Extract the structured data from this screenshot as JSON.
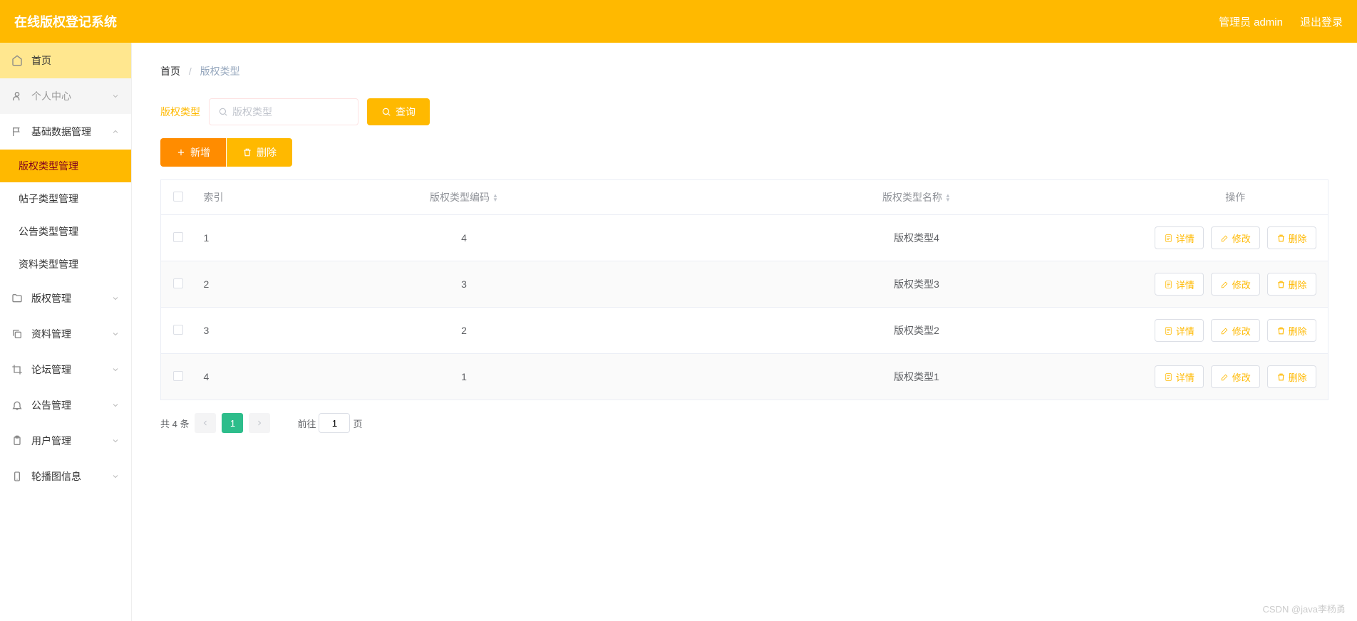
{
  "header": {
    "title": "在线版权登记系统",
    "user_label": "管理员 admin",
    "logout": "退出登录"
  },
  "sidebar": {
    "items": [
      {
        "label": "首页",
        "icon": "home",
        "kind": "home"
      },
      {
        "label": "个人中心",
        "icon": "user",
        "kind": "collapsible",
        "chevron": "down"
      },
      {
        "label": "基础数据管理",
        "icon": "flag",
        "kind": "collapsible",
        "chevron": "up",
        "children": [
          {
            "label": "版权类型管理",
            "active": true
          },
          {
            "label": "帖子类型管理"
          },
          {
            "label": "公告类型管理"
          },
          {
            "label": "资料类型管理"
          }
        ]
      },
      {
        "label": "版权管理",
        "icon": "folder",
        "kind": "collapsible",
        "chevron": "down"
      },
      {
        "label": "资料管理",
        "icon": "copy",
        "kind": "collapsible",
        "chevron": "down"
      },
      {
        "label": "论坛管理",
        "icon": "crop",
        "kind": "collapsible",
        "chevron": "down"
      },
      {
        "label": "公告管理",
        "icon": "bell",
        "kind": "collapsible",
        "chevron": "down"
      },
      {
        "label": "用户管理",
        "icon": "clipboard",
        "kind": "collapsible",
        "chevron": "down"
      },
      {
        "label": "轮播图信息",
        "icon": "phone",
        "kind": "collapsible",
        "chevron": "down"
      }
    ]
  },
  "breadcrumb": {
    "home": "首页",
    "current": "版权类型"
  },
  "filter": {
    "label": "版权类型",
    "placeholder": "版权类型",
    "search_btn": "查询"
  },
  "actions": {
    "add": "新增",
    "delete": "删除"
  },
  "table": {
    "headers": {
      "index": "索引",
      "code": "版权类型编码",
      "name": "版权类型名称",
      "action": "操作"
    },
    "rows": [
      {
        "index": "1",
        "code": "4",
        "name": "版权类型4"
      },
      {
        "index": "2",
        "code": "3",
        "name": "版权类型3"
      },
      {
        "index": "3",
        "code": "2",
        "name": "版权类型2"
      },
      {
        "index": "4",
        "code": "1",
        "name": "版权类型1"
      }
    ],
    "row_actions": {
      "detail": "详情",
      "edit": "修改",
      "delete": "删除"
    }
  },
  "pagination": {
    "total_text": "共 4 条",
    "current": "1",
    "goto_prefix": "前往",
    "goto_value": "1",
    "goto_suffix": "页"
  },
  "watermark": "CSDN @java李杨勇"
}
